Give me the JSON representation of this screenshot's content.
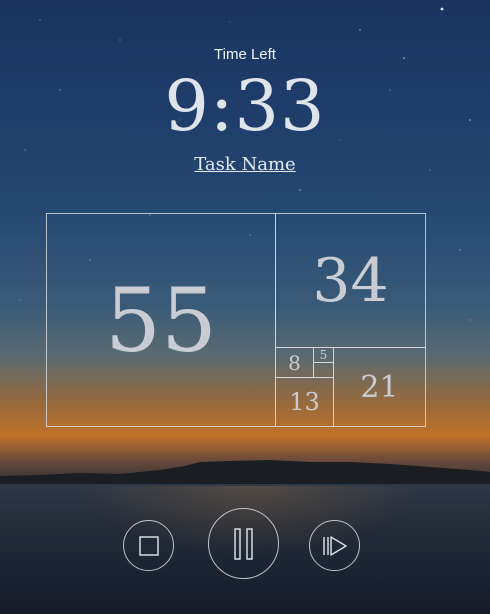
{
  "timer": {
    "label": "Time Left",
    "value": "9:33",
    "task_name": "Task Name"
  },
  "fibonacci": {
    "cells": [
      "55",
      "34",
      "21",
      "13",
      "8",
      "5"
    ]
  },
  "controls": {
    "stop_icon": "stop-icon",
    "pause_icon": "pause-icon",
    "skip_icon": "skip-forward-icon"
  }
}
